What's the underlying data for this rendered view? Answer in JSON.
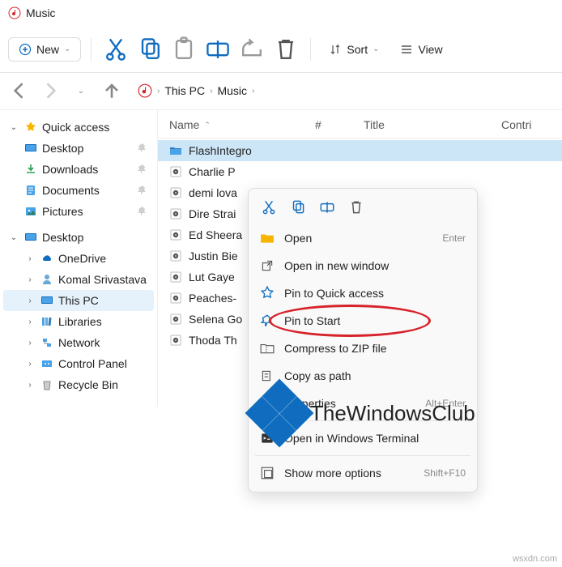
{
  "window": {
    "title": "Music"
  },
  "toolbar": {
    "new_label": "New",
    "sort_label": "Sort",
    "view_label": "View"
  },
  "breadcrumb": {
    "items": [
      "This PC",
      "Music"
    ]
  },
  "sidebar": {
    "quick_access": {
      "label": "Quick access",
      "items": [
        {
          "label": "Desktop"
        },
        {
          "label": "Downloads"
        },
        {
          "label": "Documents"
        },
        {
          "label": "Pictures"
        }
      ]
    },
    "desktop": {
      "label": "Desktop",
      "items": [
        {
          "label": "OneDrive"
        },
        {
          "label": "Komal Srivastava"
        },
        {
          "label": "This PC"
        },
        {
          "label": "Libraries"
        },
        {
          "label": "Network"
        },
        {
          "label": "Control Panel"
        },
        {
          "label": "Recycle Bin"
        }
      ]
    }
  },
  "columns": {
    "name": "Name",
    "num": "#",
    "title": "Title",
    "contrib": "Contri"
  },
  "files": [
    {
      "name": "FlashIntegro",
      "type": "folder",
      "selected": true
    },
    {
      "name": "Charlie P",
      "type": "audio"
    },
    {
      "name": "demi lova",
      "type": "audio"
    },
    {
      "name": "Dire Strai",
      "type": "audio"
    },
    {
      "name": "Ed Sheera",
      "type": "audio"
    },
    {
      "name": "Justin Bie",
      "type": "audio"
    },
    {
      "name": "Lut Gaye",
      "type": "audio"
    },
    {
      "name": "Peaches-",
      "type": "audio"
    },
    {
      "name": "Selena Go",
      "type": "audio"
    },
    {
      "name": "Thoda Th",
      "type": "audio"
    }
  ],
  "context_menu": {
    "items": [
      {
        "label": "Open",
        "icon": "folder",
        "shortcut": "Enter"
      },
      {
        "label": "Open in new window",
        "icon": "external"
      },
      {
        "label": "Pin to Quick access",
        "icon": "star"
      },
      {
        "label": "Pin to Start",
        "icon": "pin"
      },
      {
        "label": "Compress to ZIP file",
        "icon": "zip"
      },
      {
        "label": "Copy as path",
        "icon": "copy-path"
      },
      {
        "label": "Properties",
        "icon": "properties",
        "shortcut": "Alt+Enter"
      },
      {
        "label": "Open in Windows Terminal",
        "icon": "terminal"
      },
      {
        "label": "Show more options",
        "icon": "more",
        "shortcut": "Shift+F10"
      }
    ]
  },
  "watermark": {
    "text": "TheWindowsClub"
  },
  "source": "wsxdn.com"
}
